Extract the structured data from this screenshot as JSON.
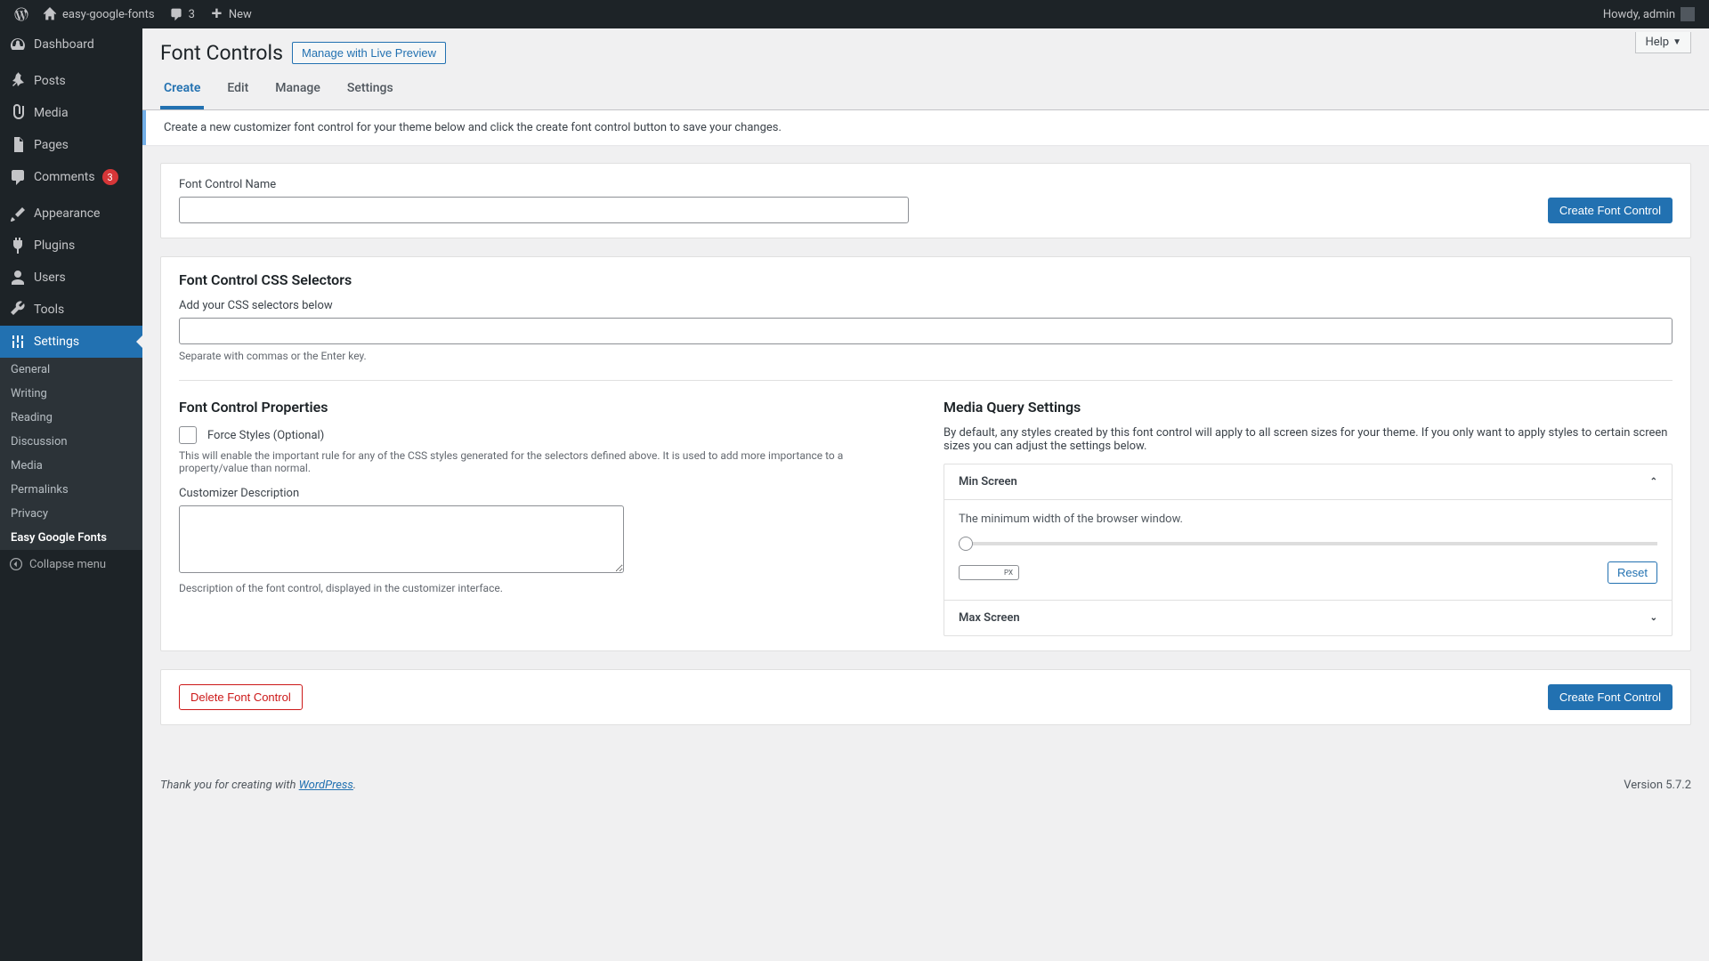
{
  "adminbar": {
    "site_name": "easy-google-fonts",
    "comments_count": "3",
    "new_label": "New",
    "howdy": "Howdy, admin"
  },
  "sidebar": {
    "items": [
      {
        "label": "Dashboard"
      },
      {
        "label": "Posts"
      },
      {
        "label": "Media"
      },
      {
        "label": "Pages"
      },
      {
        "label": "Comments",
        "badge": "3"
      },
      {
        "label": "Appearance"
      },
      {
        "label": "Plugins"
      },
      {
        "label": "Users"
      },
      {
        "label": "Tools"
      },
      {
        "label": "Settings"
      }
    ],
    "submenu": [
      {
        "label": "General"
      },
      {
        "label": "Writing"
      },
      {
        "label": "Reading"
      },
      {
        "label": "Discussion"
      },
      {
        "label": "Media"
      },
      {
        "label": "Permalinks"
      },
      {
        "label": "Privacy"
      },
      {
        "label": "Easy Google Fonts"
      }
    ],
    "collapse": "Collapse menu"
  },
  "header": {
    "help": "Help",
    "title": "Font Controls",
    "manage_preview": "Manage with Live Preview",
    "tabs": [
      {
        "label": "Create"
      },
      {
        "label": "Edit"
      },
      {
        "label": "Manage"
      },
      {
        "label": "Settings"
      }
    ],
    "notice": "Create a new customizer font control for your theme below and click the create font control button to save your changes."
  },
  "form": {
    "name_label": "Font Control Name",
    "create_button": "Create Font Control",
    "css_title": "Font Control CSS Selectors",
    "css_label": "Add your CSS selectors below",
    "css_hint": "Separate with commas or the Enter key.",
    "props_title": "Font Control Properties",
    "force_styles_label": "Force Styles (Optional)",
    "force_styles_desc": "This will enable the important rule for any of the CSS styles generated for the selectors defined above. It is used to add more importance to a property/value than normal.",
    "desc_label": "Customizer Description",
    "desc_hint": "Description of the font control, displayed in the customizer interface.",
    "media_title": "Media Query Settings",
    "media_desc": "By default, any styles created by this font control will apply to all screen sizes for your theme. If you only want to apply styles to certain screen sizes you can adjust the settings below.",
    "min_screen": "Min Screen",
    "min_screen_desc": "The minimum width of the browser window.",
    "unit": "PX",
    "reset": "Reset",
    "max_screen": "Max Screen",
    "delete_button": "Delete Font Control"
  },
  "footer": {
    "thanks_prefix": "Thank you for creating with ",
    "wp": "WordPress",
    "period": ".",
    "version": "Version 5.7.2"
  }
}
